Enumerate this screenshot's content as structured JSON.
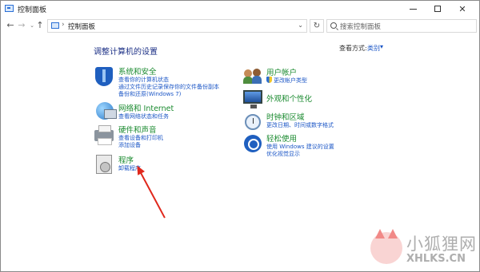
{
  "window": {
    "title": "控制面板",
    "controls": {
      "minimize": "–",
      "maximize": "□",
      "close": "✕"
    }
  },
  "nav": {
    "back": "←",
    "forward": "→",
    "recent": "⌄",
    "up": "↑",
    "breadcrumb_sep": "›",
    "address": "控制面板",
    "address_dropdown": "⌄",
    "refresh": "↻",
    "search_placeholder": "搜索控制面板"
  },
  "main": {
    "heading": "调整计算机的设置",
    "view_by_label": "查看方式:",
    "view_by_value": "类别",
    "view_by_arrow": "▾",
    "left_categories": [
      {
        "icon": "shield-icon",
        "title": "系统和安全",
        "links": [
          "查看你的计算机状态",
          "通过文件历史记录保存你的文件备份副本",
          "备份和还原(Windows 7)"
        ]
      },
      {
        "icon": "network-icon",
        "title": "网络和 Internet",
        "links": [
          "查看网络状态和任务"
        ]
      },
      {
        "icon": "printer-icon",
        "title": "硬件和声音",
        "links": [
          "查看设备和打印机",
          "添加设备"
        ]
      },
      {
        "icon": "program-icon",
        "title": "程序",
        "links": [
          "卸载程序"
        ]
      }
    ],
    "right_categories": [
      {
        "icon": "user-accounts-icon",
        "title": "用户帐户",
        "links": [
          "更改帐户类型"
        ]
      },
      {
        "icon": "monitor-icon",
        "title": "外观和个性化",
        "links": []
      },
      {
        "icon": "clock-icon",
        "title": "时钟和区域",
        "links": [
          "更改日期、时间或数字格式"
        ]
      },
      {
        "icon": "accessibility-icon",
        "title": "轻松使用",
        "links": [
          "使用 Windows 建议的设置",
          "优化视觉显示"
        ]
      }
    ]
  },
  "watermark": {
    "cn": "小狐狸网",
    "en": "XHLKS.CN",
    "accent": "#f07d7b"
  },
  "colors": {
    "heading": "#1e3287",
    "category_title": "#1a8a2f",
    "link": "#1b56c6",
    "arrow": "#e0281c"
  }
}
